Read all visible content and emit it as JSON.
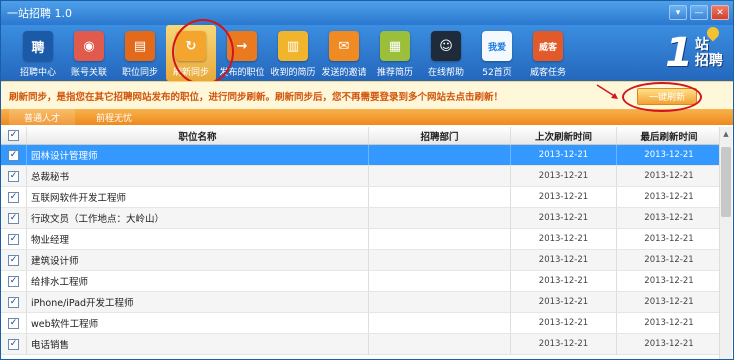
{
  "window": {
    "title": "一站招聘 1.0"
  },
  "toolbar": {
    "items": [
      {
        "label": "招聘中心",
        "icon": "pin-icon",
        "color": "#1b5aa6",
        "glyph": "聘"
      },
      {
        "label": "账号关联",
        "icon": "users-icon",
        "color": "#e05b4d",
        "glyph": "◉"
      },
      {
        "label": "职位同步",
        "icon": "document-icon",
        "color": "#e26a1a",
        "glyph": "▤"
      },
      {
        "label": "刷新同步",
        "icon": "refresh-icon",
        "color": "#f3a52d",
        "glyph": "↻"
      },
      {
        "label": "发布的职位",
        "icon": "publish-icon",
        "color": "#ea7a1f",
        "glyph": "→"
      },
      {
        "label": "收到的简历",
        "icon": "inbox-icon",
        "color": "#f1b52d",
        "glyph": "▥"
      },
      {
        "label": "发送的邀请",
        "icon": "mail-icon",
        "color": "#f08a22",
        "glyph": "✉"
      },
      {
        "label": "推荐简历",
        "icon": "resume-icon",
        "color": "#9bbf3a",
        "glyph": "▦"
      },
      {
        "label": "在线帮助",
        "icon": "qq-icon",
        "color": "#1f2a3a",
        "glyph": "☺"
      },
      {
        "label": "52首页",
        "icon": "home-icon",
        "color": "#f4f8ff",
        "glyph": "我爱"
      },
      {
        "label": "威客任务",
        "icon": "task-icon",
        "color": "#e2592a",
        "glyph": "威客"
      }
    ]
  },
  "logo": {
    "digit": "1",
    "line1": "站",
    "line2": "招聘"
  },
  "notice": {
    "text": "刷新同步，是指您在其它招聘网站发布的职位，进行同步刷新。刷新同步后，您不再需要登录到多个网站去点击刷新！",
    "button": "一键刷新"
  },
  "tabs": [
    "普通人才",
    "前程无忧"
  ],
  "table": {
    "headers": {
      "check": "✓",
      "name": "职位名称",
      "dept": "招聘部门",
      "last": "上次刷新时间",
      "final": "最后刷新时间"
    },
    "rows": [
      {
        "name": "园林设计管理师",
        "dept": "",
        "last": "2013-12-21",
        "final": "2013-12-21",
        "checked": "✓"
      },
      {
        "name": "总裁秘书",
        "dept": "",
        "last": "2013-12-21",
        "final": "2013-12-21",
        "checked": "✓"
      },
      {
        "name": "互联网软件开发工程师",
        "dept": "",
        "last": "2013-12-21",
        "final": "2013-12-21",
        "checked": "✓"
      },
      {
        "name": "行政文员（工作地点：大岭山）",
        "dept": "",
        "last": "2013-12-21",
        "final": "2013-12-21",
        "checked": "✓"
      },
      {
        "name": "物业经理",
        "dept": "",
        "last": "2013-12-21",
        "final": "2013-12-21",
        "checked": "✓"
      },
      {
        "name": "建筑设计师",
        "dept": "",
        "last": "2013-12-21",
        "final": "2013-12-21",
        "checked": "✓"
      },
      {
        "name": "给排水工程师",
        "dept": "",
        "last": "2013-12-21",
        "final": "2013-12-21",
        "checked": "✓"
      },
      {
        "name": "iPhone/iPad开发工程师",
        "dept": "",
        "last": "2013-12-21",
        "final": "2013-12-21",
        "checked": "✓"
      },
      {
        "name": "web软件工程师",
        "dept": "",
        "last": "2013-12-21",
        "final": "2013-12-21",
        "checked": "✓"
      },
      {
        "name": "电话销售",
        "dept": "",
        "last": "2013-12-21",
        "final": "2013-12-21",
        "checked": "✓"
      }
    ]
  },
  "colors": {
    "accent": "#2a78cf",
    "selected_row": "#3399ff",
    "tab_bar": "#ee8a1c",
    "notice_text": "#d0560d",
    "annotation": "#d4141c"
  }
}
